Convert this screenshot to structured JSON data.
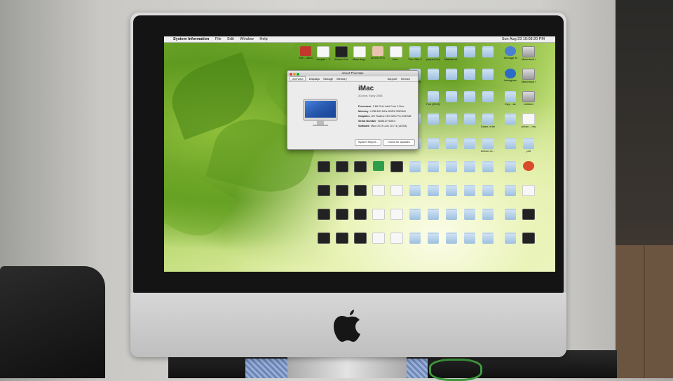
{
  "menubar": {
    "apple_symbol": "",
    "app_name": "System Information",
    "items": [
      "File",
      "Edit",
      "Window",
      "Help"
    ],
    "clock": "Sun Aug 23  10:08:20 PM"
  },
  "about_window": {
    "title": "About This Mac",
    "tabs": [
      "Overview",
      "Displays",
      "Storage",
      "Memory"
    ],
    "right_tabs": [
      "Support",
      "Service"
    ],
    "model": "iMac",
    "subtitle": "20-inch, Early 2008",
    "specs": [
      {
        "label": "Processor",
        "value": "2.66 GHz Intel Core 2 Duo"
      },
      {
        "label": "Memory",
        "value": "4 GB 800 MHz DDR2 SDRAM"
      },
      {
        "label": "Graphics",
        "value": "ATI Radeon HD 2600 Pro 256 MB"
      },
      {
        "label": "Serial Number",
        "value": "W8813776ZE3"
      },
      {
        "label": "Software",
        "value": "Mac OS X Lion 10.7.4 (11E53)"
      }
    ],
    "buttons": {
      "system_report": "System Report...",
      "check_updates": "Check for Updates"
    }
  },
  "desktop_icons": {
    "top_row": [
      "The ...afé.tif",
      "Jumper... 200 .jpg",
      "Ariana Gra...4",
      "Mary Ang...ocx",
      "phone.JPG",
      "Lato..."
    ],
    "labels_a": [
      "The Little Cat...CQ",
      "paynet Screen...",
      "Maleficent...",
      "",
      "Teenage Mutant...",
      "Macintosh HD"
    ],
    "labels_b": [
      "Toy Story",
      "",
      "",
      "",
      "Instagram",
      "Macintosh HD"
    ],
    "labels_c": [
      "",
      "Fun (2012)",
      "",
      "",
      "Kay ...sk",
      "Untitled"
    ],
    "labels_d": [
      "",
      "",
      "",
      "Dawn of the ...pes",
      "",
      "photo ...mask"
    ],
    "labels_e": [
      "",
      "",
      "",
      "before ex ...pes",
      "",
      "pdf"
    ],
    "right_icons": [
      "Macintosh HD",
      "Macintosh HD",
      "Untitled",
      "photo ...mask"
    ]
  }
}
